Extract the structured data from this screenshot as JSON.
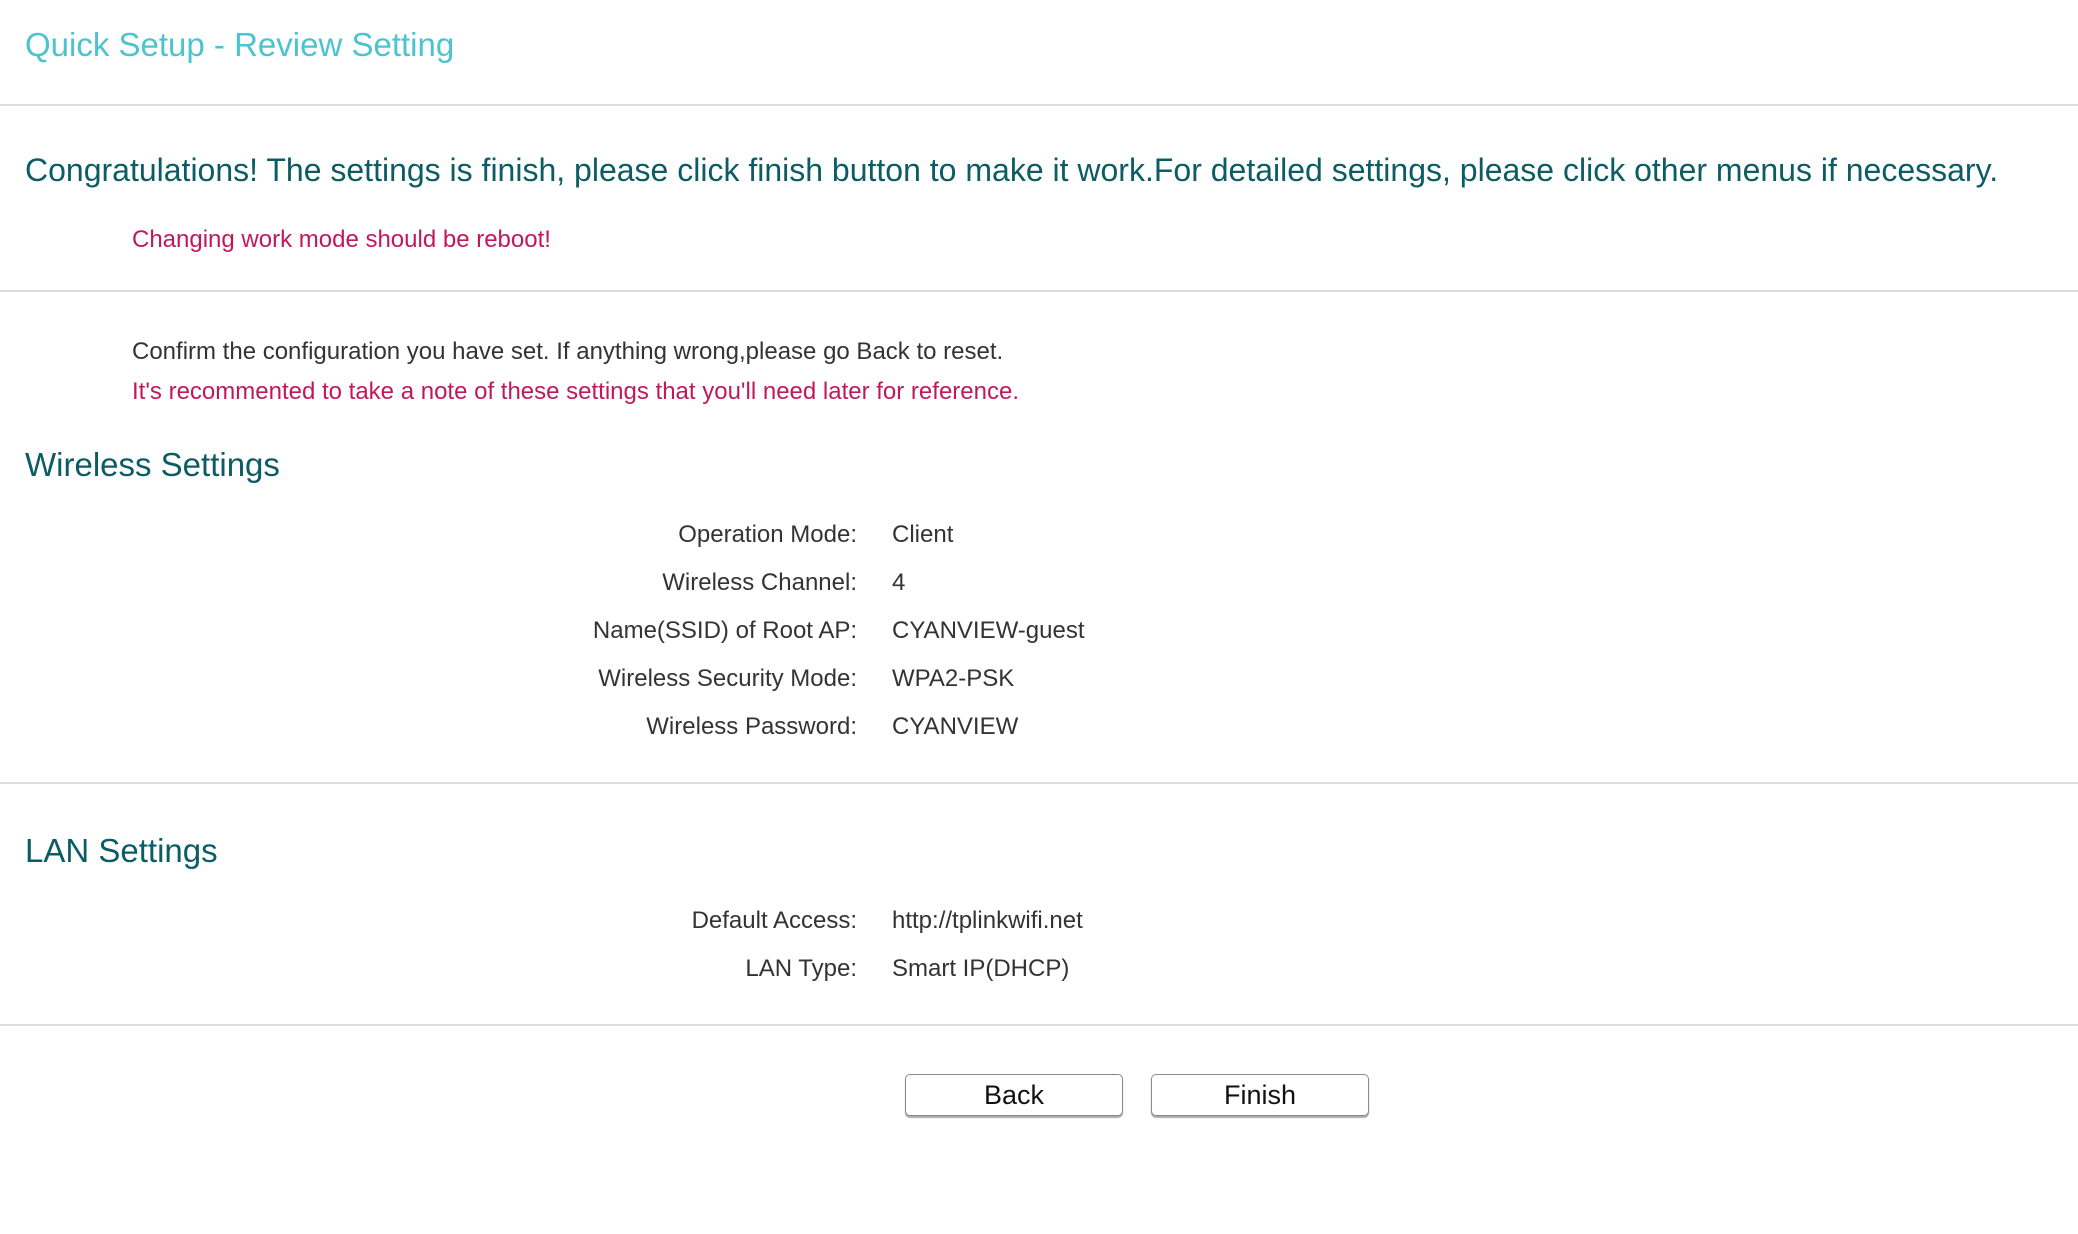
{
  "header": {
    "title": "Quick Setup - Review Setting"
  },
  "notice": {
    "congrats": "Congratulations! The settings is finish, please click finish button to make it work.For detailed settings, please click other menus if necessary.",
    "reboot_warning": "Changing work mode should be reboot!"
  },
  "confirm": {
    "text": "Confirm the configuration you have set. If anything wrong,please go Back to reset.",
    "note": "It's recommented to take a note of these settings that you'll need later for reference."
  },
  "wireless": {
    "title": "Wireless Settings",
    "rows": [
      {
        "label": "Operation Mode:",
        "value": "Client"
      },
      {
        "label": "Wireless Channel:",
        "value": "4"
      },
      {
        "label": "Name(SSID) of Root AP:",
        "value": "CYANVIEW-guest"
      },
      {
        "label": "Wireless Security Mode:",
        "value": "WPA2-PSK"
      },
      {
        "label": "Wireless Password:",
        "value": "CYANVIEW"
      }
    ]
  },
  "lan": {
    "title": "LAN Settings",
    "rows": [
      {
        "label": "Default Access:",
        "value": "http://tplinkwifi.net"
      },
      {
        "label": "LAN Type:",
        "value": "Smart IP(DHCP)"
      }
    ]
  },
  "buttons": {
    "back": "Back",
    "finish": "Finish"
  },
  "colors": {
    "title": "#4cc3cf",
    "heading": "#0c5c64",
    "warning": "#c2185b"
  }
}
